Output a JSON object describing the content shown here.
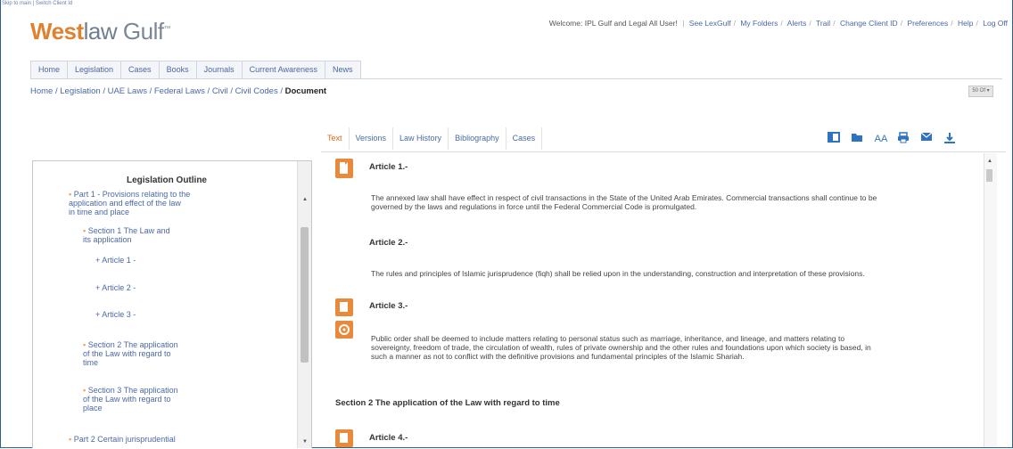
{
  "skip_text": "Skip to main | Switch Client Id",
  "logo": {
    "part1": "West",
    "part2": "law",
    "part3": " Gulf",
    "mark": "™"
  },
  "top_nav": {
    "welcome": "Welcome: IPL Gulf and Legal All User!",
    "links": [
      "See LexGulf",
      "My Folders",
      "Alerts",
      "Trail",
      "Change Client ID",
      "Preferences",
      "Help",
      "Log Off"
    ]
  },
  "main_nav": [
    "Home",
    "Legislation",
    "Cases",
    "Books",
    "Journals",
    "Current Awareness",
    "News"
  ],
  "breadcrumb": {
    "path": "Home / Legislation / UAE Laws / Federal Laws / Civil / Civil Codes / ",
    "current": "Document"
  },
  "page_control": "50 Of ▾",
  "doc_tabs": [
    "Text",
    "Versions",
    "Law History",
    "Bibliography",
    "Cases"
  ],
  "toolbar_icons": [
    "layout-icon",
    "folder-icon",
    "font-size-icon",
    "print-icon",
    "email-icon",
    "download-icon"
  ],
  "toolbar_font_label": "AA",
  "outline": {
    "title": "Legislation Outline",
    "part1": [
      "Part 1 - Provisions relating to the",
      "application and effect of the law",
      "in time and place"
    ],
    "section1": [
      "Section 1 The Law and",
      "its application"
    ],
    "articles": [
      "Article 1 -",
      "Article 2 -",
      "Article 3 -"
    ],
    "section2": [
      "Section 2 The application",
      "of the Law with regard to",
      "time"
    ],
    "section3": [
      "Section 3 The application",
      "of the Law with regard to",
      "place"
    ],
    "part2": "Part 2 Certain jurisprudential"
  },
  "document": {
    "article1_title": "Article 1.-",
    "article1_text": [
      "The annexed law shall have effect in respect of civil transactions in the State of the United Arab Emirates. Commercial transactions shall continue to be",
      "governed by the laws and regulations in force until the Federal Commercial Code is promulgated."
    ],
    "article2_title": "Article 2.-",
    "article2_text": "The rules and principles of Islamic jurisprudence (fiqh) shall be relied upon in the understanding, construction and interpretation of these provisions.",
    "article3_title": "Article 3.-",
    "article3_text": [
      "Public order shall be deemed to include matters relating to personal status such as marriage, inheritance, and lineage, and matters relating to",
      "sovereignty, freedom of trade, the circulation of wealth, rules of private ownership and the other rules and foundations upon which society is based, in",
      "such a manner as not to conflict with the definitive provisions and fundamental principles of the Islamic Shariah."
    ],
    "section2_title": "Section 2 The application of the Law with regard to time",
    "article4_title": "Article 4.-"
  }
}
